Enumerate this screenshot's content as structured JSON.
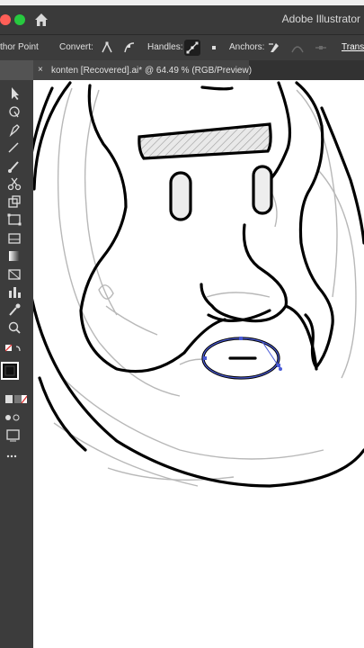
{
  "app": {
    "title": "Adobe Illustrator"
  },
  "window_controls": [
    "close",
    "minimize",
    "maximize"
  ],
  "control_bar": {
    "tool_label": "thor Point",
    "convert_label": "Convert:",
    "handles_label": "Handles:",
    "anchors_label": "Anchors:",
    "transform_label": "Trans"
  },
  "document": {
    "tab_label": "konten [Recovered].ai* @ 64.49 % (RGB/Preview)",
    "close_symbol": "×"
  },
  "tools": [
    "selection-tool",
    "direct-selection-tool",
    "pen-tool",
    "type-tool",
    "line-tool",
    "rectangle-tool",
    "brush-tool",
    "eraser-tool",
    "rotate-tool",
    "scale-tool",
    "free-transform-tool",
    "symbol-sprayer-tool",
    "column-graph-tool",
    "gradient-tool",
    "eyedropper-tool",
    "blend-tool",
    "zoom-tool",
    "hand-tool",
    "fill-stroke-swatch",
    "screen-mode",
    "more-tools"
  ],
  "colors": {
    "selection": "#4a5bd6",
    "artwork": "#000000",
    "sketch": "#b8b8b8"
  }
}
